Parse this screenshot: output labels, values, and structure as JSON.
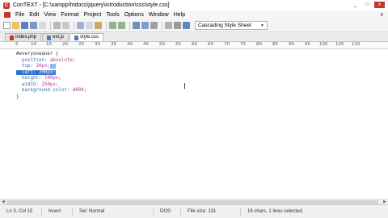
{
  "window": {
    "title": "ConTEXT - [C:\\xampp\\htdocs\\jquery\\introduction\\css\\style.css]",
    "controls": [
      "_",
      "□",
      "x"
    ]
  },
  "menu": {
    "items": [
      "File",
      "Edit",
      "View",
      "Format",
      "Project",
      "Tools",
      "Options",
      "Window",
      "Help"
    ],
    "close_glyph": "x"
  },
  "toolbar": {
    "syntax_selected": "Cascading Style Sheet"
  },
  "tabs": [
    {
      "label": "index.php",
      "active": false
    },
    {
      "label": "ext.js",
      "active": false
    },
    {
      "label": "style.css",
      "active": true
    }
  ],
  "ruler": {
    "ticks": [
      "5",
      "10",
      "15",
      "20",
      "25",
      "30",
      "35",
      "40",
      "45",
      "50",
      "55",
      "60",
      "65",
      "70",
      "75",
      "80",
      "85",
      "90",
      "95",
      "100",
      "105",
      "110"
    ]
  },
  "editor": {
    "lines": [
      {
        "selector": "#everyoneaner {"
      },
      {
        "prop": "position:",
        "val": "absolute;"
      },
      {
        "prop": "top:",
        "val": "20px;",
        "partial": true
      },
      {
        "prop": "left:",
        "val": "200px;",
        "highlight": true
      },
      {
        "prop": "height:",
        "val": "100px;"
      },
      {
        "prop": "width:",
        "val": "250px;"
      },
      {
        "prop": "background-color:",
        "val": "#000;"
      },
      {
        "selector": "}"
      }
    ]
  },
  "status": {
    "position": "Ln 3, Col 15",
    "mode": "Insert",
    "selection": "Sel: Normal",
    "format": "DOS",
    "file_size": "File size: 131",
    "info": "16 chars, 1 lines selected."
  },
  "colors": {
    "selection": "#2f6fd1",
    "property": "#3b6db0",
    "value": "#b03a8a",
    "brand": "#c8322c"
  }
}
